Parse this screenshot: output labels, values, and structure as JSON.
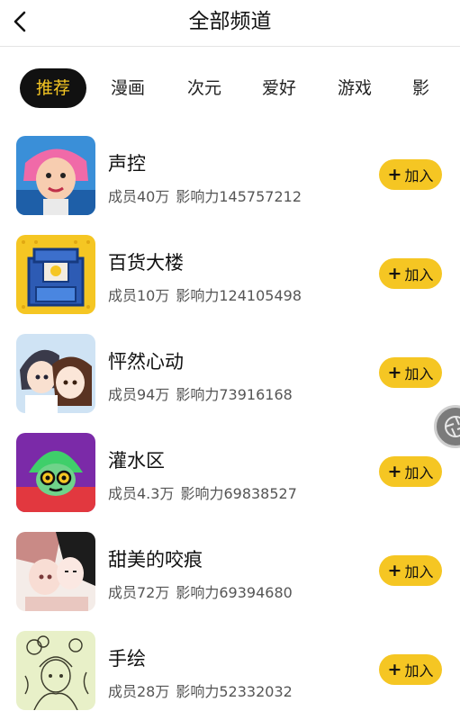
{
  "header": {
    "title": "全部频道",
    "back_icon": "back-arrow-icon"
  },
  "tabs": [
    {
      "label": "推荐",
      "active": true
    },
    {
      "label": "漫画"
    },
    {
      "label": "次元"
    },
    {
      "label": "爱好"
    },
    {
      "label": "游戏"
    },
    {
      "label": "影"
    }
  ],
  "channels": [
    {
      "name": "声控",
      "members": "成员40万",
      "influence": "影响力145757212",
      "join_label": "加入"
    },
    {
      "name": "百货大楼",
      "members": "成员10万",
      "influence": "影响力124105498",
      "join_label": "加入"
    },
    {
      "name": "怦然心动",
      "members": "成员94万",
      "influence": "影响力73916168",
      "join_label": "加入"
    },
    {
      "name": "灌水区",
      "members": "成员4.3万",
      "influence": "影响力69838527",
      "join_label": "加入"
    },
    {
      "name": "甜美的咬痕",
      "members": "成员72万",
      "influence": "影响力69394680",
      "join_label": "加入"
    },
    {
      "name": "手绘",
      "members": "成员28万",
      "influence": "影响力52332032",
      "join_label": "加入"
    }
  ],
  "colors": {
    "accent": "#f5c623",
    "active_tab_bg": "#111111"
  },
  "floating_button_icon": "camera-shutter-icon"
}
